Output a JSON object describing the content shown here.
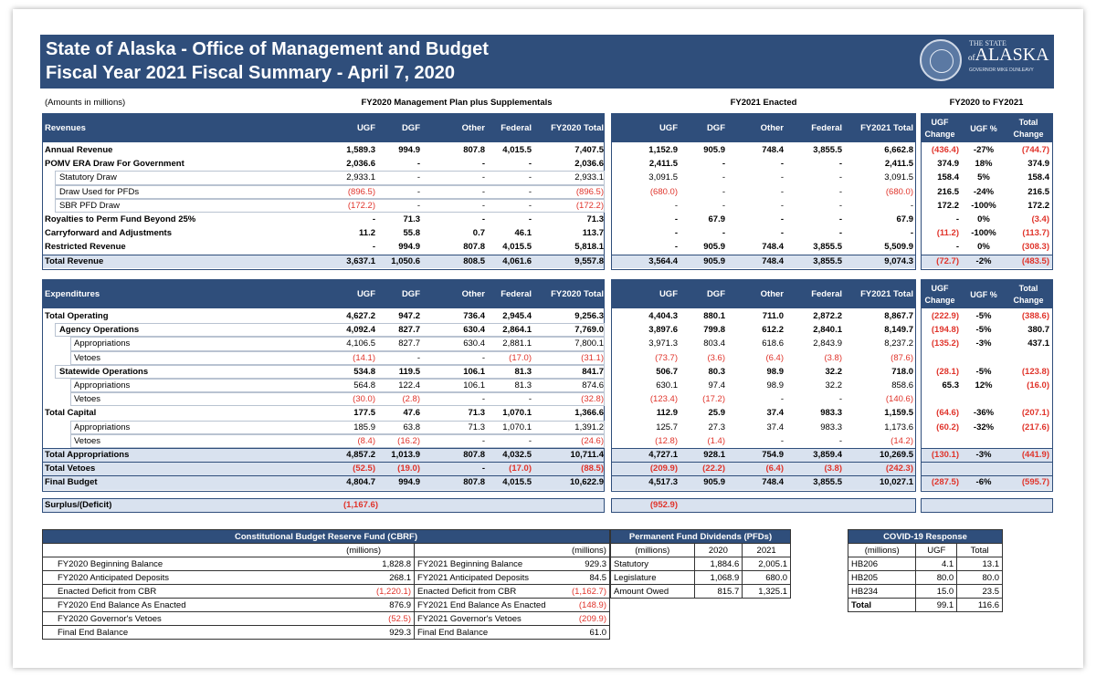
{
  "title1": "State of Alaska - Office of Management and Budget",
  "title2": "Fiscal Year 2021 Fiscal Summary - April 7, 2020",
  "brand": {
    "top": "THE STATE",
    "of": "of",
    "name": "ALASKA",
    "sub": "GOVERNOR MIKE DUNLEAVY"
  },
  "units": "(Amounts in millions)",
  "sec": {
    "fy20": "FY2020 Management Plan plus Supplementals",
    "fy21": "FY2021 Enacted",
    "chg": "FY2020 to FY2021"
  },
  "cols20": [
    "UGF",
    "DGF",
    "Other",
    "Federal",
    "FY2020 Total"
  ],
  "cols21": [
    "UGF",
    "DGF",
    "Other",
    "Federal",
    "FY2021 Total"
  ],
  "colsChg": [
    "UGF Change",
    "UGF %",
    "Total Change"
  ],
  "rev_label": "Revenues",
  "exp_label": "Expenditures",
  "revenues": [
    {
      "l": "Annual Revenue",
      "b": 1,
      "i": 0,
      "a": [
        "1,589.3",
        "994.9",
        "807.8",
        "4,015.5",
        "7,407.5"
      ],
      "e": [
        "1,152.9",
        "905.9",
        "748.4",
        "3,855.5",
        "6,662.8"
      ],
      "c": [
        "(436.4)",
        "-27%",
        "(744.7)"
      ]
    },
    {
      "l": "POMV ERA Draw For Government",
      "b": 1,
      "i": 0,
      "a": [
        "2,036.6",
        "-",
        "-",
        "-",
        "2,036.6"
      ],
      "e": [
        "2,411.5",
        "-",
        "-",
        "-",
        "2,411.5"
      ],
      "c": [
        "374.9",
        "18%",
        "374.9"
      ]
    },
    {
      "l": "Statutory Draw",
      "b": 0,
      "i": 1,
      "a": [
        "2,933.1",
        "-",
        "-",
        "-",
        "2,933.1"
      ],
      "e": [
        "3,091.5",
        "-",
        "-",
        "-",
        "3,091.5"
      ],
      "c": [
        "158.4",
        "5%",
        "158.4"
      ]
    },
    {
      "l": "Draw Used for PFDs",
      "b": 0,
      "i": 1,
      "a": [
        "(896.5)",
        "-",
        "-",
        "-",
        "(896.5)"
      ],
      "e": [
        "(680.0)",
        "-",
        "-",
        "-",
        "(680.0)"
      ],
      "c": [
        "216.5",
        "-24%",
        "216.5"
      ]
    },
    {
      "l": "SBR PFD Draw",
      "b": 0,
      "i": 1,
      "a": [
        "(172.2)",
        "-",
        "-",
        "-",
        "(172.2)"
      ],
      "e": [
        "-",
        "-",
        "-",
        "-",
        "-"
      ],
      "c": [
        "172.2",
        "-100%",
        "172.2"
      ]
    },
    {
      "l": "Royalties to Perm Fund Beyond 25%",
      "b": 1,
      "i": 0,
      "a": [
        "-",
        "71.3",
        "-",
        "-",
        "71.3"
      ],
      "e": [
        "-",
        "67.9",
        "-",
        "-",
        "67.9"
      ],
      "c": [
        "-",
        "0%",
        "(3.4)"
      ]
    },
    {
      "l": "Carryforward and Adjustments",
      "b": 1,
      "i": 0,
      "a": [
        "11.2",
        "55.8",
        "0.7",
        "46.1",
        "113.7"
      ],
      "e": [
        "-",
        "-",
        "-",
        "-",
        "-"
      ],
      "c": [
        "(11.2)",
        "-100%",
        "(113.7)"
      ]
    },
    {
      "l": "Restricted Revenue",
      "b": 1,
      "i": 0,
      "a": [
        "-",
        "994.9",
        "807.8",
        "4,015.5",
        "5,818.1"
      ],
      "e": [
        "-",
        "905.9",
        "748.4",
        "3,855.5",
        "5,509.9"
      ],
      "c": [
        "-",
        "0%",
        "(308.3)"
      ]
    },
    {
      "l": "Total Revenue",
      "b": 1,
      "i": 0,
      "t": 1,
      "a": [
        "3,637.1",
        "1,050.6",
        "808.5",
        "4,061.6",
        "9,557.8"
      ],
      "e": [
        "3,564.4",
        "905.9",
        "748.4",
        "3,855.5",
        "9,074.3"
      ],
      "c": [
        "(72.7)",
        "-2%",
        "(483.5)"
      ]
    }
  ],
  "expenditures": [
    {
      "l": "Total Operating",
      "b": 1,
      "i": 0,
      "a": [
        "4,627.2",
        "947.2",
        "736.4",
        "2,945.4",
        "9,256.3"
      ],
      "e": [
        "4,404.3",
        "880.1",
        "711.0",
        "2,872.2",
        "8,867.7"
      ],
      "c": [
        "(222.9)",
        "-5%",
        "(388.6)"
      ]
    },
    {
      "l": "Agency Operations",
      "b": 1,
      "i": 1,
      "a": [
        "4,092.4",
        "827.7",
        "630.4",
        "2,864.1",
        "7,769.0"
      ],
      "e": [
        "3,897.6",
        "799.8",
        "612.2",
        "2,840.1",
        "8,149.7"
      ],
      "c": [
        "(194.8)",
        "-5%",
        "380.7"
      ]
    },
    {
      "l": "Appropriations",
      "b": 0,
      "i": 2,
      "a": [
        "4,106.5",
        "827.7",
        "630.4",
        "2,881.1",
        "7,800.1"
      ],
      "e": [
        "3,971.3",
        "803.4",
        "618.6",
        "2,843.9",
        "8,237.2"
      ],
      "c": [
        "(135.2)",
        "-3%",
        "437.1"
      ]
    },
    {
      "l": "Vetoes",
      "b": 0,
      "i": 2,
      "a": [
        "(14.1)",
        "-",
        "-",
        "(17.0)",
        "(31.1)"
      ],
      "e": [
        "(73.7)",
        "(3.6)",
        "(6.4)",
        "(3.8)",
        "(87.6)"
      ],
      "c": [
        "",
        "",
        ""
      ]
    },
    {
      "l": "Statewide Operations",
      "b": 1,
      "i": 1,
      "a": [
        "534.8",
        "119.5",
        "106.1",
        "81.3",
        "841.7"
      ],
      "e": [
        "506.7",
        "80.3",
        "98.9",
        "32.2",
        "718.0"
      ],
      "c": [
        "(28.1)",
        "-5%",
        "(123.8)"
      ]
    },
    {
      "l": "Appropriations",
      "b": 0,
      "i": 2,
      "a": [
        "564.8",
        "122.4",
        "106.1",
        "81.3",
        "874.6"
      ],
      "e": [
        "630.1",
        "97.4",
        "98.9",
        "32.2",
        "858.6"
      ],
      "c": [
        "65.3",
        "12%",
        "(16.0)"
      ]
    },
    {
      "l": "Vetoes",
      "b": 0,
      "i": 2,
      "a": [
        "(30.0)",
        "(2.8)",
        "-",
        "-",
        "(32.8)"
      ],
      "e": [
        "(123.4)",
        "(17.2)",
        "-",
        "-",
        "(140.6)"
      ],
      "c": [
        "",
        "",
        ""
      ]
    },
    {
      "l": "Total Capital",
      "b": 1,
      "i": 0,
      "a": [
        "177.5",
        "47.6",
        "71.3",
        "1,070.1",
        "1,366.6"
      ],
      "e": [
        "112.9",
        "25.9",
        "37.4",
        "983.3",
        "1,159.5"
      ],
      "c": [
        "(64.6)",
        "-36%",
        "(207.1)"
      ]
    },
    {
      "l": "Appropriations",
      "b": 0,
      "i": 2,
      "a": [
        "185.9",
        "63.8",
        "71.3",
        "1,070.1",
        "1,391.2"
      ],
      "e": [
        "125.7",
        "27.3",
        "37.4",
        "983.3",
        "1,173.6"
      ],
      "c": [
        "(60.2)",
        "-32%",
        "(217.6)"
      ]
    },
    {
      "l": "Vetoes",
      "b": 0,
      "i": 2,
      "a": [
        "(8.4)",
        "(16.2)",
        "-",
        "-",
        "(24.6)"
      ],
      "e": [
        "(12.8)",
        "(1.4)",
        "-",
        "-",
        "(14.2)"
      ],
      "c": [
        "",
        "",
        ""
      ]
    },
    {
      "l": "Total Appropriations",
      "b": 1,
      "i": 0,
      "t": 1,
      "a": [
        "4,857.2",
        "1,013.9",
        "807.8",
        "4,032.5",
        "10,711.4"
      ],
      "e": [
        "4,727.1",
        "928.1",
        "754.9",
        "3,859.4",
        "10,269.5"
      ],
      "c": [
        "(130.1)",
        "-3%",
        "(441.9)"
      ]
    },
    {
      "l": "Total Vetoes",
      "b": 1,
      "i": 0,
      "t": 1,
      "a": [
        "(52.5)",
        "(19.0)",
        "-",
        "(17.0)",
        "(88.5)"
      ],
      "e": [
        "(209.9)",
        "(22.2)",
        "(6.4)",
        "(3.8)",
        "(242.3)"
      ],
      "c": [
        "",
        "",
        ""
      ]
    },
    {
      "l": "Final Budget",
      "b": 1,
      "i": 0,
      "t": 1,
      "a": [
        "4,804.7",
        "994.9",
        "807.8",
        "4,015.5",
        "10,622.9"
      ],
      "e": [
        "4,517.3",
        "905.9",
        "748.4",
        "3,855.5",
        "10,027.1"
      ],
      "c": [
        "(287.5)",
        "-6%",
        "(595.7)"
      ]
    }
  ],
  "surplus": {
    "label": "Surplus/(Deficit)",
    "fy20": "(1,167.6)",
    "fy21": "(952.9)"
  },
  "cbrf": {
    "title": "Constitutional Budget Reserve Fund (CBRF)",
    "unit": "(millions)",
    "rows": [
      [
        "FY2020 Beginning Balance",
        "1,828.8",
        "FY2021 Beginning Balance",
        "929.3"
      ],
      [
        "FY2020 Anticipated Deposits",
        "268.1",
        "FY2021 Anticipated Deposits",
        "84.5"
      ],
      [
        "Enacted Deficit from CBR",
        "(1,220.1)",
        "Enacted Deficit from CBR",
        "(1,162.7)"
      ],
      [
        "FY2020 End Balance As Enacted",
        "876.9",
        "FY2021 End Balance As Enacted",
        "(148.9)"
      ],
      [
        "FY2020 Governor's Vetoes",
        "(52.5)",
        "FY2021 Governor's Vetoes",
        "(209.9)"
      ],
      [
        "Final End Balance",
        "929.3",
        "Final End Balance",
        "61.0"
      ]
    ]
  },
  "pfd": {
    "title": "Permanent Fund Dividends (PFDs)",
    "head": [
      "(millions)",
      "2020",
      "2021"
    ],
    "rows": [
      [
        "Statutory",
        "1,884.6",
        "2,005.1"
      ],
      [
        "Legislature",
        "1,068.9",
        "680.0"
      ],
      [
        "Amount Owed",
        "815.7",
        "1,325.1"
      ]
    ]
  },
  "covid": {
    "title": "COVID-19 Response",
    "head": [
      "(millions)",
      "UGF",
      "Total"
    ],
    "rows": [
      [
        "HB206",
        "4.1",
        "13.1"
      ],
      [
        "HB205",
        "80.0",
        "80.0"
      ],
      [
        "HB234",
        "15.0",
        "23.5"
      ],
      [
        "Total",
        "99.1",
        "116.6"
      ]
    ]
  },
  "negColor": "#e0342b",
  "headerColor": "#2f4e7b"
}
